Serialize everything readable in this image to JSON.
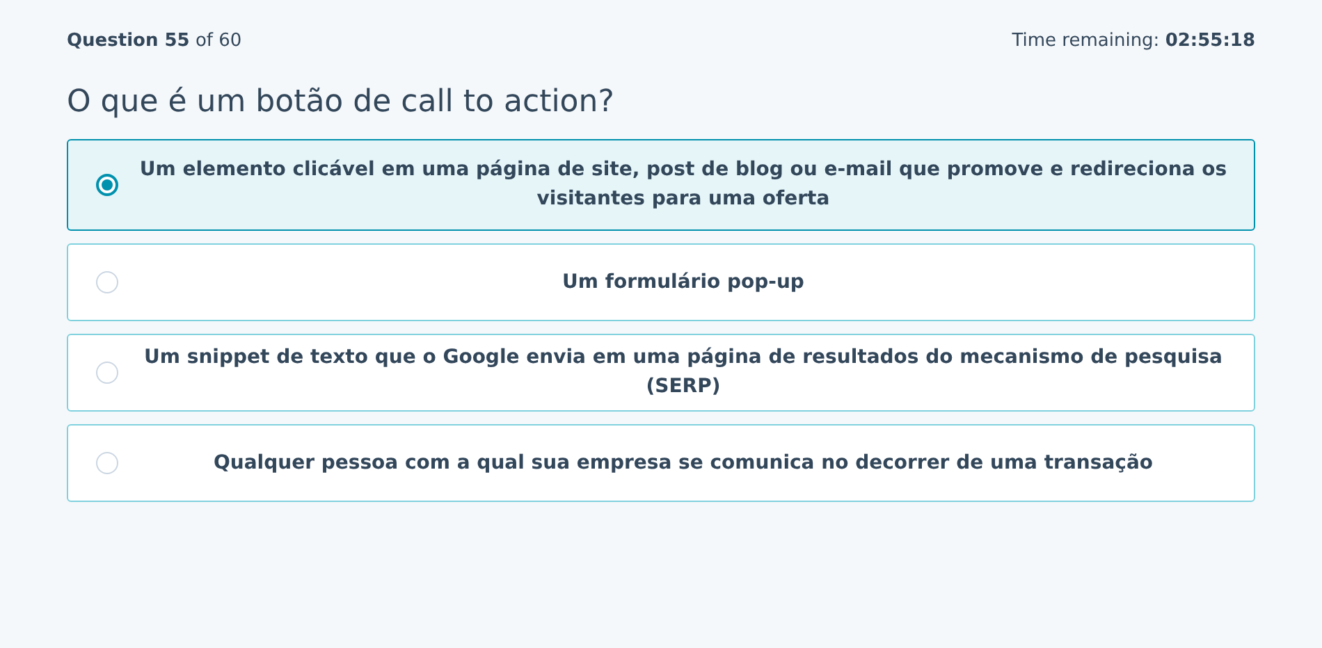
{
  "progress": "**Question 55** of 60",
  "timer": "Time remaining: **02:55:18**",
  "question": "O que é um botão de call to action?",
  "options": [
    {
      "text": "Um elemento clicável em uma página de site, post de blog ou e-mail que promove e redireciona os visitantes para uma oferta",
      "selected": true
    },
    {
      "text": "Um formulário pop-up",
      "selected": false
    },
    {
      "text": "Um snippet de texto que o Google envia em uma página de resultados do mecanismo de pesquisa (SERP)",
      "selected": false
    },
    {
      "text": "Qualquer pessoa com a qual sua empresa se comunica no decorrer de uma transação",
      "selected": false
    }
  ]
}
